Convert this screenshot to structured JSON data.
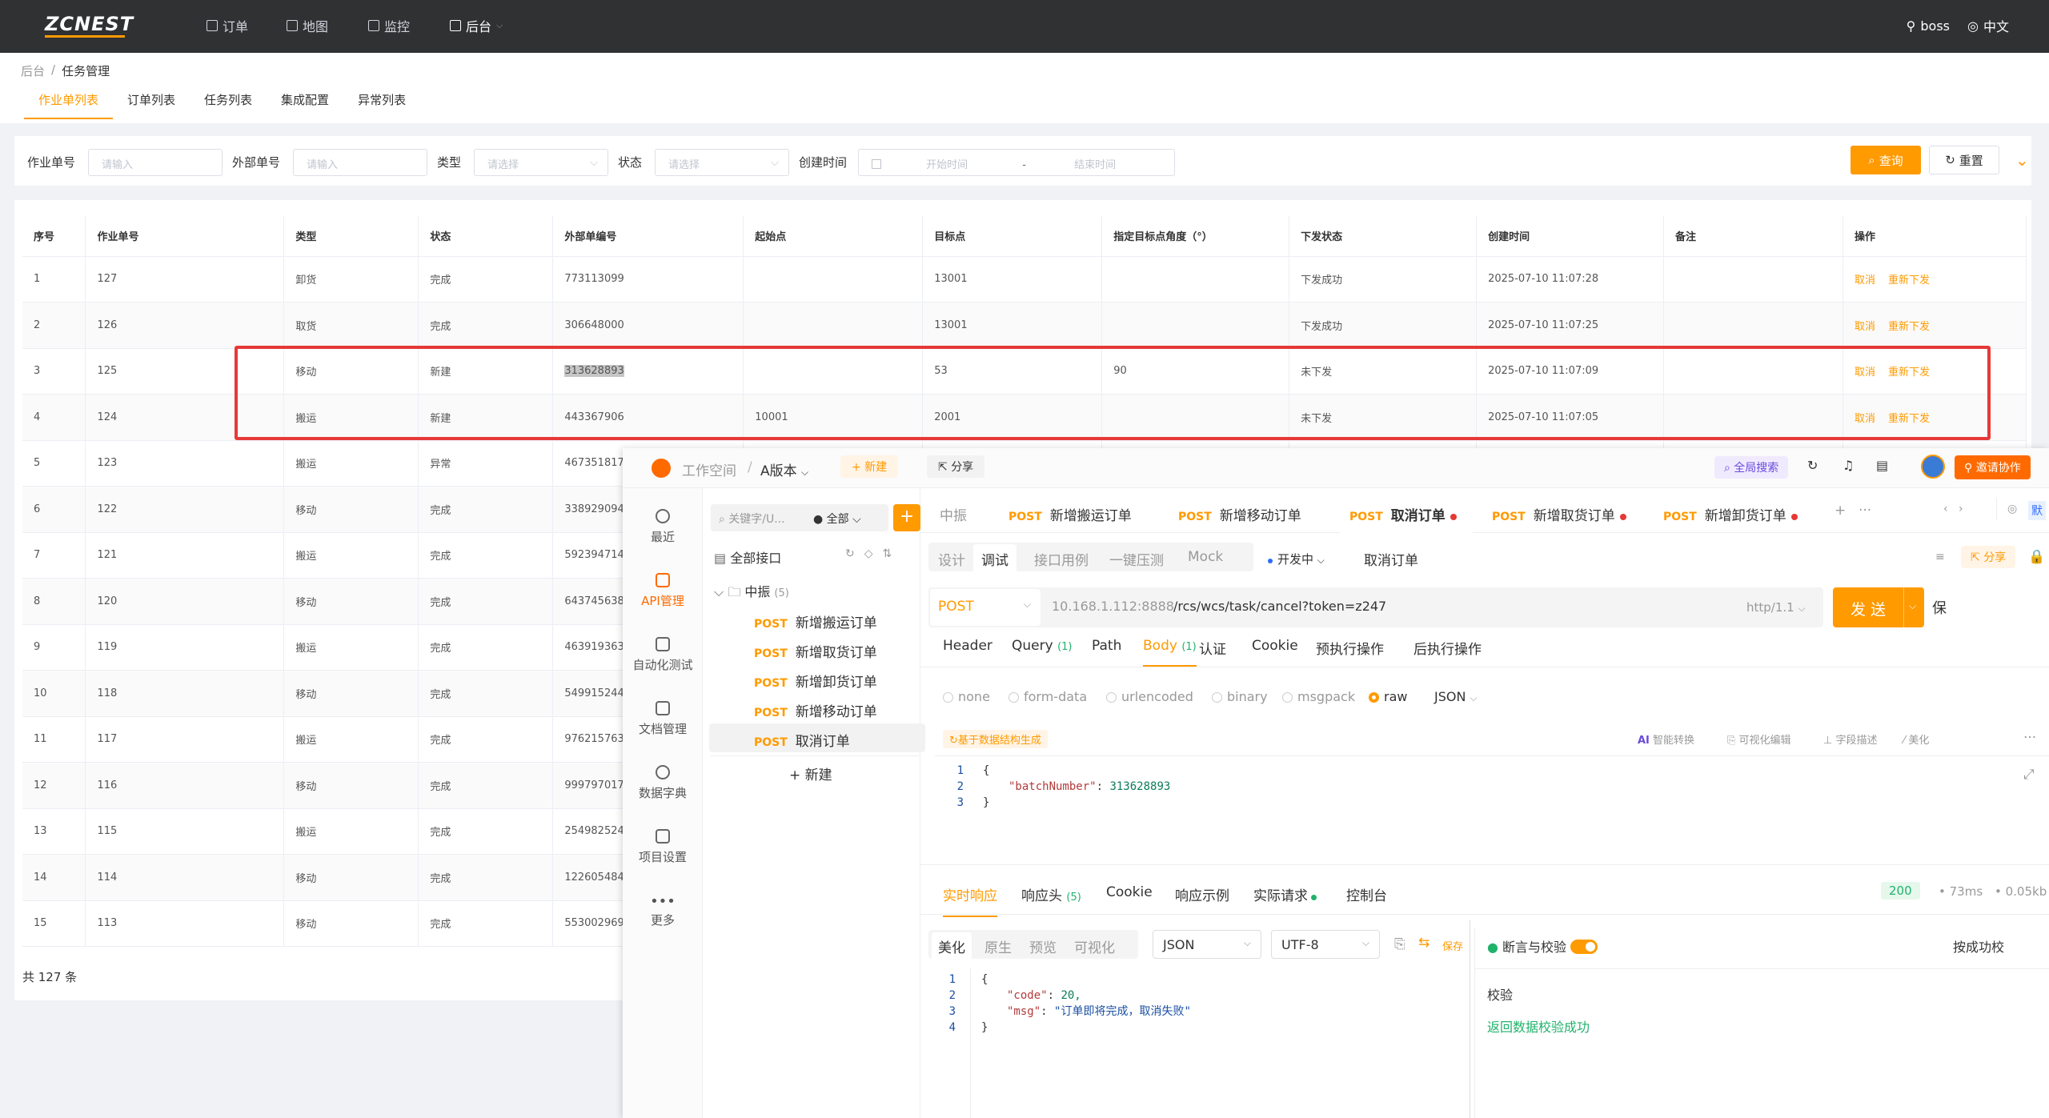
{
  "topbar": {
    "logo": "ZCNEST",
    "nav": [
      "订单",
      "地图",
      "监控",
      "后台"
    ],
    "user": "boss",
    "lang": "中文"
  },
  "breadcrumb": [
    "后台",
    "任务管理"
  ],
  "tabs": [
    "作业单列表",
    "订单列表",
    "任务列表",
    "集成配置",
    "异常列表"
  ],
  "filter": {
    "job_no_label": "作业单号",
    "job_no_ph": "请输入",
    "ext_no_label": "外部单号",
    "ext_no_ph": "请输入",
    "type_label": "类型",
    "type_ph": "请选择",
    "status_label": "状态",
    "status_ph": "请选择",
    "created_label": "创建时间",
    "start_ph": "开始时间",
    "dash": "-",
    "end_ph": "结束时间",
    "search": "查询",
    "reset": "重置"
  },
  "table": {
    "headers": [
      "序号",
      "作业单号",
      "类型",
      "状态",
      "外部单编号",
      "起始点",
      "目标点",
      "指定目标点角度（°）",
      "下发状态",
      "创建时间",
      "备注",
      "操作"
    ],
    "rows": [
      [
        "1",
        "127",
        "卸货",
        "完成",
        "773113099",
        "",
        "13001",
        "",
        "下发成功",
        "2025-07-10 11:07:28",
        ""
      ],
      [
        "2",
        "126",
        "取货",
        "完成",
        "306648000",
        "",
        "13001",
        "",
        "下发成功",
        "2025-07-10 11:07:25",
        ""
      ],
      [
        "3",
        "125",
        "移动",
        "新建",
        "313628893",
        "",
        "53",
        "90",
        "未下发",
        "2025-07-10 11:07:09",
        ""
      ],
      [
        "4",
        "124",
        "搬运",
        "新建",
        "443367906",
        "10001",
        "2001",
        "",
        "未下发",
        "2025-07-10 11:07:05",
        ""
      ],
      [
        "5",
        "123",
        "搬运",
        "异常",
        "467351817",
        "",
        "",
        "",
        "",
        "",
        ""
      ],
      [
        "6",
        "122",
        "移动",
        "完成",
        "338929094",
        "",
        "",
        "",
        "",
        "",
        ""
      ],
      [
        "7",
        "121",
        "搬运",
        "完成",
        "592394714",
        "",
        "",
        "",
        "",
        "",
        ""
      ],
      [
        "8",
        "120",
        "移动",
        "完成",
        "643745638",
        "",
        "",
        "",
        "",
        "",
        ""
      ],
      [
        "9",
        "119",
        "搬运",
        "完成",
        "463919363",
        "",
        "",
        "",
        "",
        "",
        ""
      ],
      [
        "10",
        "118",
        "移动",
        "完成",
        "549915244",
        "",
        "",
        "",
        "",
        "",
        ""
      ],
      [
        "11",
        "117",
        "搬运",
        "完成",
        "976215763",
        "",
        "",
        "",
        "",
        "",
        ""
      ],
      [
        "12",
        "116",
        "移动",
        "完成",
        "999797017",
        "",
        "",
        "",
        "",
        "",
        ""
      ],
      [
        "13",
        "115",
        "搬运",
        "完成",
        "254982524",
        "",
        "",
        "",
        "",
        "",
        ""
      ],
      [
        "14",
        "114",
        "移动",
        "完成",
        "122605484",
        "",
        "",
        "",
        "",
        "",
        ""
      ],
      [
        "15",
        "113",
        "移动",
        "完成",
        "553002969",
        "",
        "",
        "",
        "",
        "",
        ""
      ]
    ],
    "op_cancel": "取消",
    "op_resend": "重新下发",
    "total": "共 127 条"
  },
  "apifox": {
    "workspace": "工作空间",
    "sep": "/",
    "version": "A版本",
    "new": "+ 新建",
    "share": "分享",
    "global_search": "全局搜索",
    "invite": "邀请协作",
    "left_nav": [
      "最近",
      "API管理",
      "自动化测试",
      "文档管理",
      "数据字典",
      "项目设置",
      "更多"
    ],
    "tree": {
      "search_ph": "关键字/U...",
      "scope": "全部",
      "all": "全部接口",
      "folder": "中振",
      "folder_count": "(5)",
      "items": [
        "新增搬运订单",
        "新增取货订单",
        "新增卸货订单",
        "新增移动订单",
        "取消订单"
      ],
      "method": "POST",
      "new": "+ 新建"
    },
    "doc_tabs": {
      "first": "中振",
      "items": [
        "新增搬运订单",
        "新增移动订单",
        "取消订单",
        "新增取货订单",
        "新增卸货订单"
      ],
      "default": "默"
    },
    "mode_tabs": [
      "设计",
      "调试",
      "接口用例",
      "一键压测",
      "Mock"
    ],
    "env": "开发中",
    "api_name": "取消订单",
    "share_btn": "分享",
    "method": "POST",
    "host": "10.168.1.112:8888",
    "path": "/rcs/wcs/task/cancel?token=z247",
    "protocol": "http/1.1",
    "send": "发 送",
    "save_cut": "保",
    "req_tabs": [
      "Header",
      "Query",
      "Path",
      "Body",
      "认证",
      "Cookie",
      "预执行操作",
      "后执行操作"
    ],
    "query_count": "(1)",
    "body_count": "(1)",
    "body_types": [
      "none",
      "form-data",
      "urlencoded",
      "binary",
      "msgpack",
      "raw"
    ],
    "body_format": "JSON",
    "gen_btn": "基于数据结构生成",
    "tools": [
      "智能转换",
      "可视化编辑",
      "字段描述",
      "美化"
    ],
    "ai": "AI",
    "req_code": {
      "lines": [
        "1",
        "2",
        "3"
      ],
      "open": "{",
      "key": "\"batchNumber\"",
      "colon": ":",
      "value": "313628893",
      "close": "}"
    },
    "resp_tabs": [
      "实时响应",
      "响应头",
      "Cookie",
      "响应示例",
      "实际请求",
      "控制台"
    ],
    "resp_head_count": "(5)",
    "status_code": "200",
    "time": "73ms",
    "size": "0.05kb",
    "view_tabs": [
      "美化",
      "原生",
      "预览",
      "可视化"
    ],
    "resp_format": "JSON",
    "encoding": "UTF-8",
    "save": "保存",
    "assert_label": "断言与校验",
    "assert_right": "按成功校",
    "resp_code": {
      "lines": [
        "1",
        "2",
        "3",
        "4"
      ],
      "open": "{",
      "k1": "\"code\"",
      "v1": "20,",
      "k2": "\"msg\"",
      "v2": "\"订单即将完成，取消失败\"",
      "close": "}"
    },
    "check_title": "校验",
    "check_result": "返回数据校验成功"
  }
}
